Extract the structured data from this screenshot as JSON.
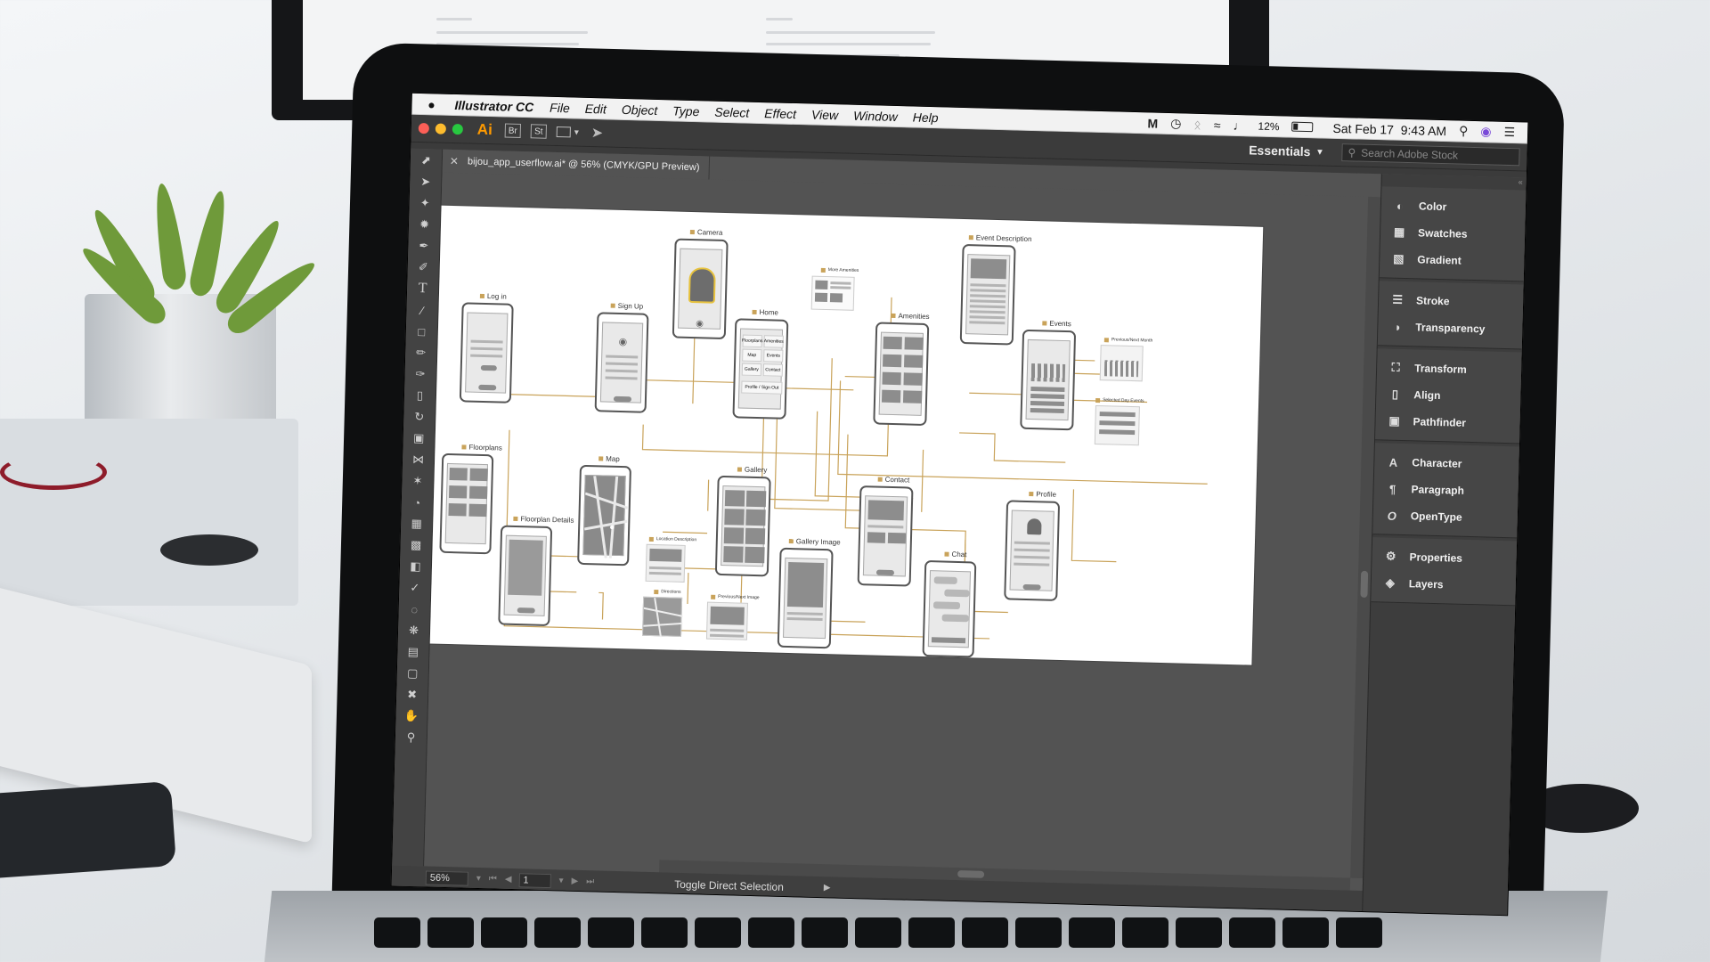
{
  "menubar": {
    "app_name": "Illustrator CC",
    "items": [
      "File",
      "Edit",
      "Object",
      "Type",
      "Select",
      "Effect",
      "View",
      "Window",
      "Help"
    ],
    "battery": "12%",
    "datetime": "Sat Feb 17  9:43 AM"
  },
  "appbar": {
    "logo": "Ai",
    "badges": [
      "Br",
      "St"
    ],
    "workspace": "Essentials",
    "stock_search_placeholder": "Search Adobe Stock"
  },
  "document": {
    "tab_title": "bijou_app_userflow.ai* @ 56% (CMYK/GPU Preview)"
  },
  "wireframes": {
    "labels": {
      "login": "Log in",
      "signup": "Sign Up",
      "camera": "Camera",
      "home": "Home",
      "more_amenities": "More Amenities",
      "amenities": "Amenities",
      "event_description": "Event Description",
      "events": "Events",
      "prev_next_month": "Previous/Next Month",
      "selected_day_events": "Selected Day Events",
      "floorplans": "Floorplans",
      "floorplan_details": "Floorplan Details",
      "map": "Map",
      "location_description": "Location Description",
      "directions": "Directions",
      "gallery": "Gallery",
      "gallery_image": "Gallery Image",
      "prev_next_image": "Previous/Next Image",
      "contact": "Contact",
      "chat": "Chat",
      "profile": "Profile"
    },
    "home_buttons": [
      "Floorplans",
      "Amenities",
      "Map",
      "Events",
      "Gallery",
      "Contact",
      "Profile / Sign Out"
    ]
  },
  "statusbar": {
    "zoom": "56%",
    "page": "1",
    "status_text": "Toggle Direct Selection"
  },
  "panels": {
    "groups": [
      [
        {
          "label": "Color",
          "icon": "color-icon"
        },
        {
          "label": "Swatches",
          "icon": "swatches-icon"
        },
        {
          "label": "Gradient",
          "icon": "gradient-icon"
        }
      ],
      [
        {
          "label": "Stroke",
          "icon": "stroke-icon"
        },
        {
          "label": "Transparency",
          "icon": "transparency-icon"
        }
      ],
      [
        {
          "label": "Transform",
          "icon": "transform-icon"
        },
        {
          "label": "Align",
          "icon": "align-icon"
        },
        {
          "label": "Pathfinder",
          "icon": "pathfinder-icon"
        }
      ],
      [
        {
          "label": "Character",
          "icon": "character-icon"
        },
        {
          "label": "Paragraph",
          "icon": "paragraph-icon"
        },
        {
          "label": "OpenType",
          "icon": "opentype-icon"
        }
      ],
      [
        {
          "label": "Properties",
          "icon": "properties-icon"
        },
        {
          "label": "Layers",
          "icon": "layers-icon"
        }
      ]
    ]
  },
  "colors": {
    "accent_ai": "#ff9a00",
    "flow_line": "#c9a35a",
    "panel_bg": "#3d3d3d"
  }
}
